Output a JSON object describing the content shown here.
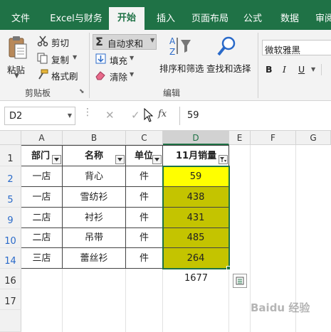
{
  "ribbon_tabs": [
    {
      "label": "文件",
      "active": false
    },
    {
      "label": "Excel与财务",
      "active": false
    },
    {
      "label": "开始",
      "active": true
    },
    {
      "label": "插入",
      "active": false
    },
    {
      "label": "页面布局",
      "active": false
    },
    {
      "label": "公式",
      "active": false
    },
    {
      "label": "数据",
      "active": false
    },
    {
      "label": "审阅",
      "active": false
    }
  ],
  "clipboard": {
    "paste": "粘贴",
    "cut": "剪切",
    "copy": "复制",
    "format_painter": "格式刷",
    "group_label": "剪贴板"
  },
  "editing": {
    "autosum": "自动求和",
    "fill": "填充",
    "clear": "清除",
    "sort_filter": "排序和筛选",
    "find_select": "查找和选择",
    "group_label": "编辑"
  },
  "font": {
    "name": "微软雅黑",
    "bold": "B",
    "italic": "I",
    "underline": "U"
  },
  "formula_bar": {
    "name_box": "D2",
    "fx": "fx",
    "value": "59"
  },
  "columns": [
    "A",
    "B",
    "C",
    "D",
    "E",
    "F",
    "G"
  ],
  "table": {
    "headers": [
      "部门",
      "名称",
      "单位",
      "11月销量"
    ],
    "rows": [
      {
        "row_num": "2",
        "dept": "一店",
        "name": "背心",
        "unit": "件",
        "sales": "59"
      },
      {
        "row_num": "5",
        "dept": "一店",
        "name": "雪纺衫",
        "unit": "件",
        "sales": "438"
      },
      {
        "row_num": "9",
        "dept": "二店",
        "name": "衬衫",
        "unit": "件",
        "sales": "431"
      },
      {
        "row_num": "10",
        "dept": "二店",
        "name": "吊带",
        "unit": "件",
        "sales": "485"
      },
      {
        "row_num": "14",
        "dept": "三店",
        "name": "蕾丝衫",
        "unit": "件",
        "sales": "264"
      }
    ],
    "header_row_num": "1",
    "total_row_num": "16",
    "total": "1677",
    "extra_row_num": "17"
  },
  "watermark": "Baidu 经验",
  "colors": {
    "ribbon_green": "#1f7246",
    "yellow": "#ffff00",
    "olive": "#c4c400"
  }
}
